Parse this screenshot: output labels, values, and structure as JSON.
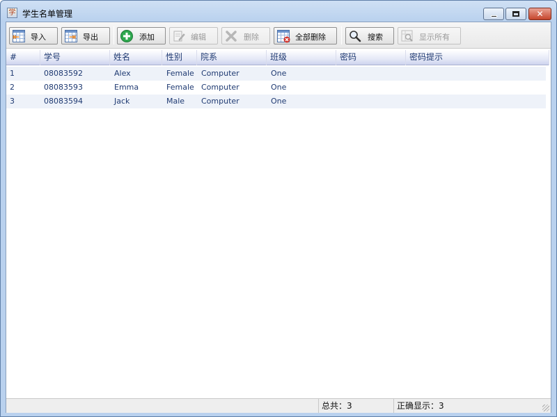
{
  "window": {
    "title": "学生名单管理",
    "app_icon": "student-list-app-icon",
    "controls": {
      "minimize": "minimize-icon",
      "maximize": "maximize-icon",
      "close": "close-icon"
    }
  },
  "toolbar": {
    "import_label": "导入",
    "export_label": "导出",
    "add_label": "添加",
    "edit_label": "编辑",
    "delete_label": "删除",
    "delete_all_label": "全部删除",
    "search_label": "搜索",
    "show_all_label": "显示所有"
  },
  "table": {
    "columns": [
      "#",
      "学号",
      "姓名",
      "性别",
      "院系",
      "班级",
      "密码",
      "密码提示"
    ],
    "rows": [
      {
        "index": "1",
        "id": "08083592",
        "name": "Alex",
        "gender": "Female",
        "dept": "Computer",
        "class": "One",
        "password": "",
        "hint": ""
      },
      {
        "index": "2",
        "id": "08083593",
        "name": "Emma",
        "gender": "Female",
        "dept": "Computer",
        "class": "One",
        "password": "",
        "hint": ""
      },
      {
        "index": "3",
        "id": "08083594",
        "name": "Jack",
        "gender": "Male",
        "dept": "Computer",
        "class": "One",
        "password": "",
        "hint": ""
      }
    ]
  },
  "status": {
    "total": "总共：3",
    "shown": "正确显示：3"
  },
  "colors": {
    "header_text": "#1f3a72",
    "alt_row": "#eef2f9",
    "add_green": "#2fa84f",
    "delete_red": "#d0342c"
  }
}
